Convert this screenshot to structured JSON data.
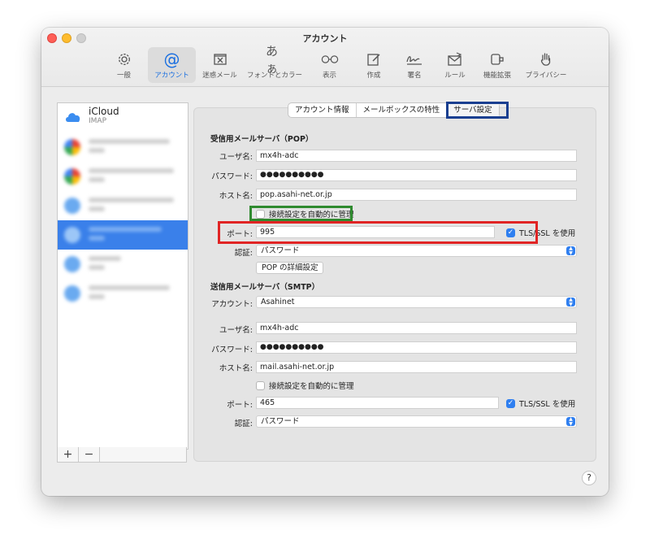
{
  "window": {
    "title": "アカウント"
  },
  "toolbar": [
    {
      "label": "一般",
      "icon": "gear-icon"
    },
    {
      "label": "アカウント",
      "icon": "at-sign-icon"
    },
    {
      "label": "迷惑メール",
      "icon": "junk-mail-icon"
    },
    {
      "label": "フォントとカラー",
      "icon": "font-icon"
    },
    {
      "label": "表示",
      "icon": "glasses-icon"
    },
    {
      "label": "作成",
      "icon": "compose-icon"
    },
    {
      "label": "署名",
      "icon": "signature-icon"
    },
    {
      "label": "ルール",
      "icon": "rules-icon"
    },
    {
      "label": "機能拡張",
      "icon": "extension-icon"
    },
    {
      "label": "プライバシー",
      "icon": "hand-icon"
    }
  ],
  "sidebar": {
    "accounts": [
      {
        "name": "iCloud",
        "type": "IMAP"
      }
    ],
    "add_label": "+",
    "remove_label": "−"
  },
  "tabs": [
    "アカウント情報",
    "メールボックスの特性",
    "サーバ設定"
  ],
  "incoming": {
    "title": "受信用メールサーバ（POP）",
    "username_label": "ユーザ名:",
    "username": "mx4h-adc",
    "password_label": "パスワード:",
    "password": "●●●●●●●●●●",
    "host_label": "ホスト名:",
    "host": "pop.asahi-net.or.jp",
    "auto_manage_label": "接続設定を自動的に管理",
    "port_label": "ポート:",
    "port": "995",
    "tls_label": "TLS/SSL を使用",
    "auth_label": "認証:",
    "auth": "パスワード",
    "advanced_button": "POP の詳細設定"
  },
  "outgoing": {
    "title": "送信用メールサーバ（SMTP）",
    "account_label": "アカウント:",
    "account": "Asahinet",
    "username_label": "ユーザ名:",
    "username": "mx4h-adc",
    "password_label": "パスワード:",
    "password": "●●●●●●●●●●",
    "host_label": "ホスト名:",
    "host": "mail.asahi-net.or.jp",
    "auto_manage_label": "接続設定を自動的に管理",
    "port_label": "ポート:",
    "port": "465",
    "tls_label": "TLS/SSL を使用",
    "auth_label": "認証:",
    "auth": "パスワード"
  },
  "help_label": "?",
  "colors": {
    "accent": "#2f7ff0",
    "highlight_red": "#e02424",
    "highlight_green": "#2f8a2f",
    "highlight_blue": "#1a3f90"
  }
}
